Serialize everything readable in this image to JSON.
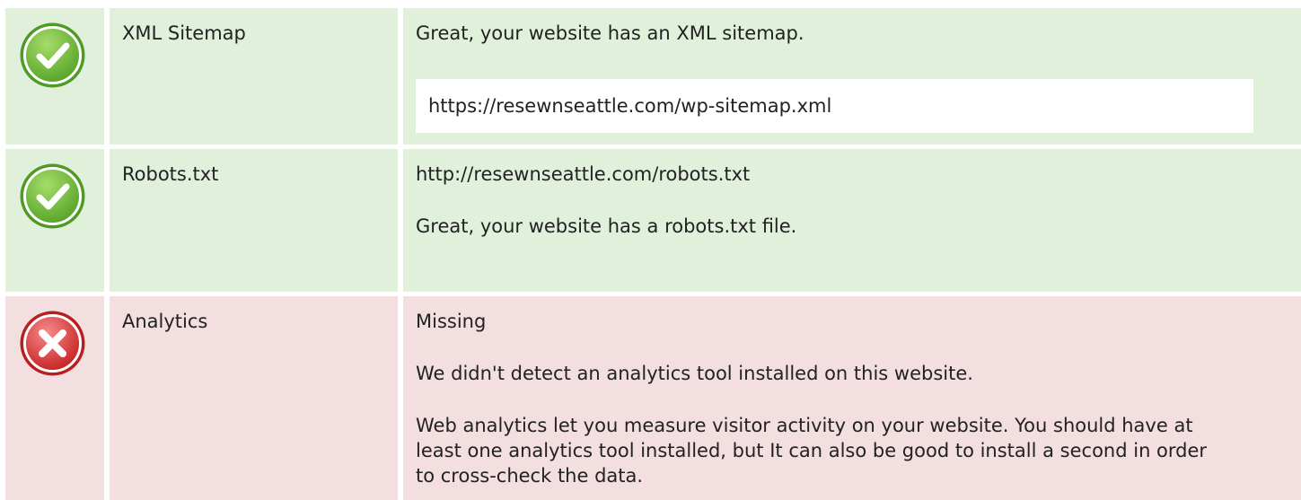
{
  "checks": [
    {
      "status": "pass",
      "icon": "check-circle-icon",
      "label": "XML Sitemap",
      "message": "Great, your website has an XML sitemap.",
      "url": "https://resewnseattle.com/wp-sitemap.xml"
    },
    {
      "status": "pass",
      "icon": "check-circle-icon",
      "label": "Robots.txt",
      "url": "http://resewnseattle.com/robots.txt",
      "message": "Great, your website has a robots.txt file."
    },
    {
      "status": "fail",
      "icon": "error-circle-icon",
      "label": "Analytics",
      "result": "Missing",
      "message": "We didn't detect an analytics tool installed on this website.",
      "description": "Web analytics let you measure visitor activity on your website. You should have at least one analytics tool installed, but It can also be good to install a second in order to cross-check the data."
    }
  ],
  "colors": {
    "pass_bg": "#e0f0da",
    "fail_bg": "#f3dee0",
    "pass_icon": "#6fbd3a",
    "fail_icon": "#dd3b3b"
  }
}
